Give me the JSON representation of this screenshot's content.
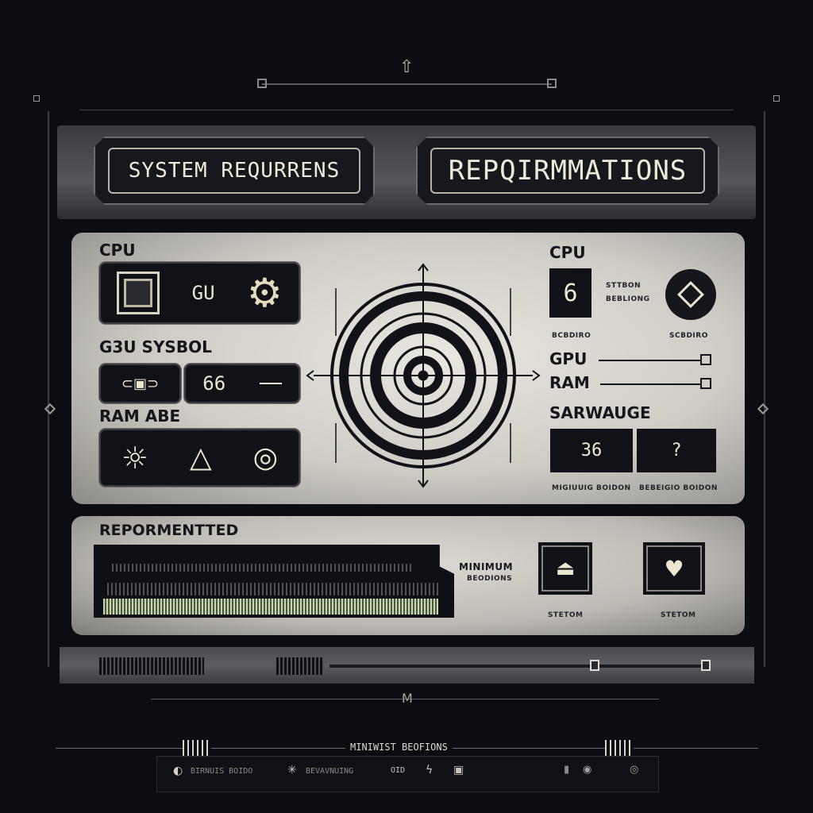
{
  "header": {
    "title_left": "SYSTEM REQURRENS",
    "title_right": "REPQIRMMATIONS"
  },
  "left_column": {
    "cpu_label": "CPU",
    "cpu_value": "GU",
    "gpu_label": "G3U SYSBOL",
    "gpu_value": "66",
    "ram_label": "RAM ABE"
  },
  "right_column": {
    "cpu_label": "CPU",
    "cpu_value": "6",
    "cpu_desc_line1": "STTBON",
    "cpu_desc_line2": "BEBLIONG",
    "caption_left": "BCBDIRO",
    "caption_right": "SCBDIRO",
    "gpu_label": "GPU",
    "ram_label": "RAM",
    "storage_label": "SARWAUGE",
    "storage_value_1": "36",
    "storage_value_2": "?",
    "storage_caption_1": "MIGIUUIG BOIDON",
    "storage_caption_2": "BEBEIGIO BOIDON"
  },
  "recommended": {
    "title": "REPORMENTTED",
    "minimum_line1": "MINIMUM",
    "minimum_line2": "BEODIONS",
    "icon1_label": "STETOM",
    "icon2_label": "STETOM"
  },
  "slider": {
    "value_fraction": 0.71
  },
  "footer": {
    "center_mark": "M",
    "title": "MINIWIST BEOFIONS",
    "item1": "BIRNUIS BOIDO",
    "item2": "BEVAVNUING",
    "item3": "OID"
  },
  "colors": {
    "background": "#0c0d13",
    "panel": "#e2dfd8",
    "dark_box": "#111217",
    "accent_text": "#ece8cf"
  }
}
